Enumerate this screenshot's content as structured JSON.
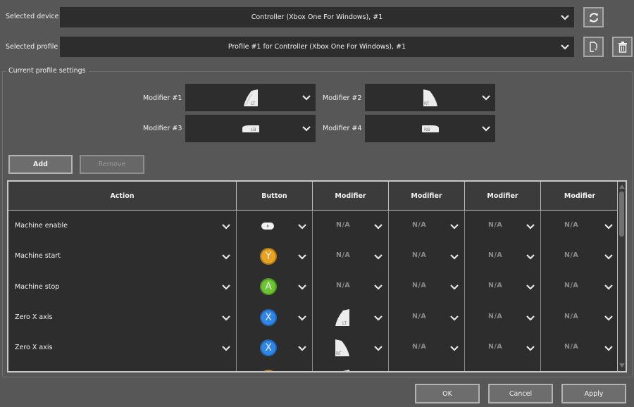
{
  "device": {
    "label": "Selected device",
    "value": "Controller (Xbox One For Windows), #1",
    "refresh_icon": "refresh-icon"
  },
  "profile": {
    "label": "Selected profile",
    "value": "Profile #1 for Controller (Xbox One For Windows), #1",
    "new_icon": "new-file-icon",
    "delete_icon": "trash-icon"
  },
  "settings": {
    "title": "Current profile settings",
    "modifiers": [
      {
        "label": "Modifier #1",
        "value": "LT"
      },
      {
        "label": "Modifier #2",
        "value": "RT"
      },
      {
        "label": "Modifier #3",
        "value": "LB"
      },
      {
        "label": "Modifier #4",
        "value": "RB"
      }
    ],
    "add_label": "Add",
    "remove_label": "Remove"
  },
  "table": {
    "headers": [
      "Action",
      "Button",
      "Modifier",
      "Modifier",
      "Modifier",
      "Modifier"
    ],
    "rows": [
      {
        "action": "Machine enable",
        "button": "Start",
        "modifiers": [
          "N/A",
          "N/A",
          "N/A",
          "N/A"
        ]
      },
      {
        "action": "Machine start",
        "button": "Y",
        "modifiers": [
          "N/A",
          "N/A",
          "N/A",
          "N/A"
        ]
      },
      {
        "action": "Machine stop",
        "button": "A",
        "modifiers": [
          "N/A",
          "N/A",
          "N/A",
          "N/A"
        ]
      },
      {
        "action": "Zero X axis",
        "button": "X",
        "modifiers": [
          "LT",
          "N/A",
          "N/A",
          "N/A"
        ]
      },
      {
        "action": "Zero X axis",
        "button": "X",
        "modifiers": [
          "RT",
          "N/A",
          "N/A",
          "N/A"
        ]
      },
      {
        "action": "",
        "button": "Y",
        "modifiers": [
          "LT",
          "",
          "",
          ""
        ]
      }
    ]
  },
  "button_colors": {
    "Y": "#e8a323",
    "A": "#6cc431",
    "X": "#2e87e8"
  },
  "footer": {
    "ok_label": "OK",
    "cancel_label": "Cancel",
    "apply_label": "Apply"
  }
}
